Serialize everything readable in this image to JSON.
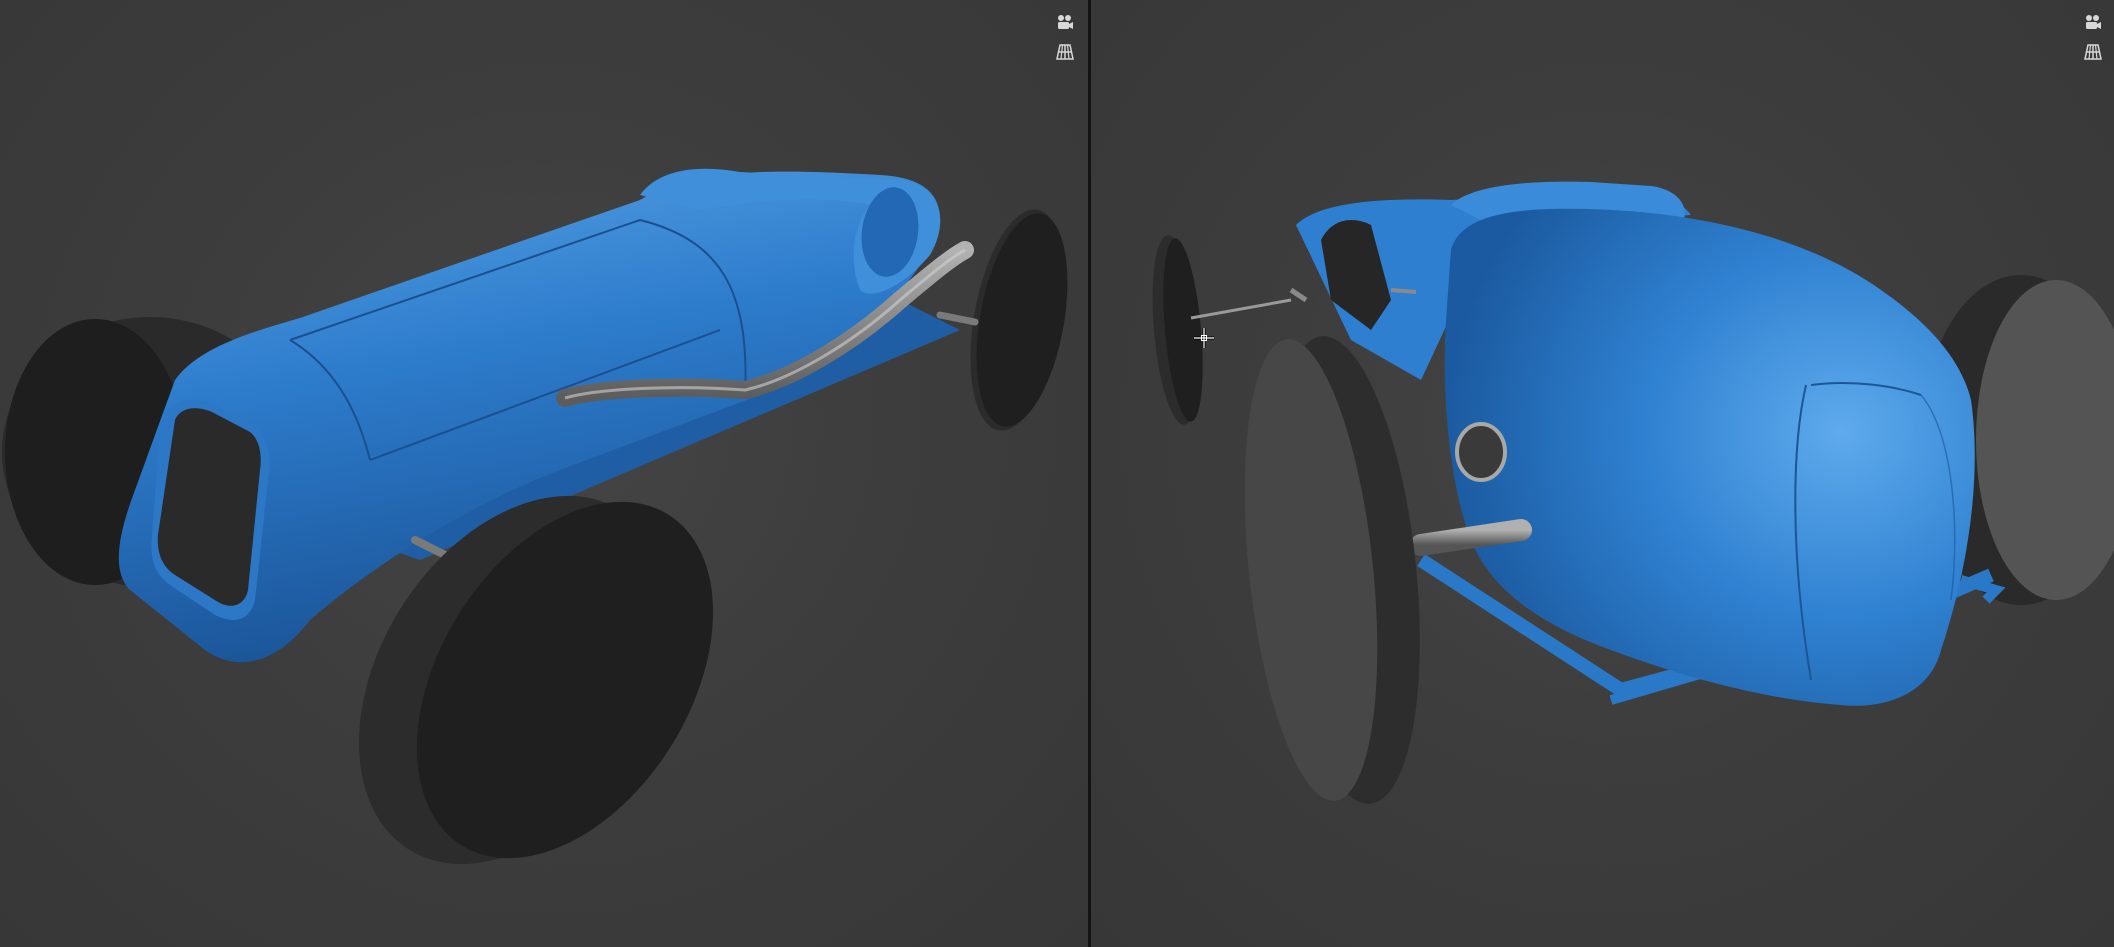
{
  "app": {
    "background_color": "#3a3a3a",
    "divider_color": "#141414"
  },
  "viewports": [
    {
      "id": "left",
      "buttons": [
        {
          "name": "camera-view-button",
          "icon": "camera-icon"
        },
        {
          "name": "perspective-grid-button",
          "icon": "grid-icon"
        }
      ]
    },
    {
      "id": "right",
      "buttons": [
        {
          "name": "camera-view-button",
          "icon": "camera-icon"
        },
        {
          "name": "perspective-grid-button",
          "icon": "grid-icon"
        }
      ]
    }
  ],
  "model": {
    "body_color": "#2f7fd0",
    "body_highlight": "#5ba6ea",
    "body_shadow": "#1d5699",
    "tire_color": "#232323",
    "tire_tread": "#4a4a4a",
    "pipe_color": "#8a8a8a"
  },
  "cursor": {
    "icon": "move-crosshair-icon"
  }
}
